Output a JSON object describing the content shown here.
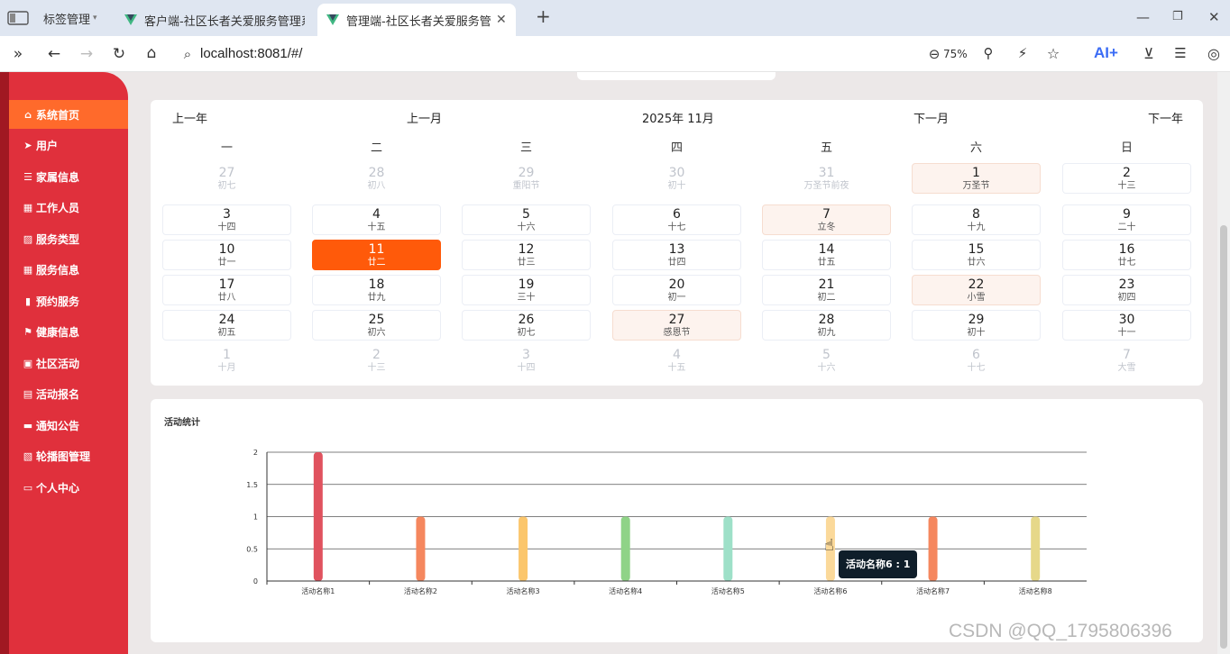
{
  "browser": {
    "tab_group_label": "标签管理",
    "tabs": [
      {
        "title": "客户端-社区长者关爱服务管理系"
      },
      {
        "title": "管理端-社区长者关爱服务管理"
      }
    ],
    "url": "localhost:8081/#/",
    "zoom": "75%",
    "ai_label": "AI+"
  },
  "sidebar": {
    "items": [
      {
        "label": "系统首页",
        "icon": "home-icon"
      },
      {
        "label": "用户",
        "icon": "paper-plane-icon"
      },
      {
        "label": "家属信息",
        "icon": "list-icon"
      },
      {
        "label": "工作人员",
        "icon": "grid-icon"
      },
      {
        "label": "服务类型",
        "icon": "chart-icon"
      },
      {
        "label": "服务信息",
        "icon": "grid-icon"
      },
      {
        "label": "预约服务",
        "icon": "bar-chart-icon"
      },
      {
        "label": "健康信息",
        "icon": "flag-icon"
      },
      {
        "label": "社区活动",
        "icon": "monitor-icon"
      },
      {
        "label": "活动报名",
        "icon": "basket-icon"
      },
      {
        "label": "通知公告",
        "icon": "comment-icon"
      },
      {
        "label": "轮播图管理",
        "icon": "clipboard-icon"
      },
      {
        "label": "个人中心",
        "icon": "card-icon"
      }
    ]
  },
  "calendar": {
    "prev_year": "上一年",
    "prev_month": "上一月",
    "title": "2025年 11月",
    "next_month": "下一月",
    "next_year": "下一年",
    "weekdays": [
      "一",
      "二",
      "三",
      "四",
      "五",
      "六",
      "日"
    ],
    "weeks": [
      [
        {
          "d": "27",
          "l": "初七",
          "t": "other"
        },
        {
          "d": "28",
          "l": "初八",
          "t": "other"
        },
        {
          "d": "29",
          "l": "重阳节",
          "t": "other"
        },
        {
          "d": "30",
          "l": "初十",
          "t": "other"
        },
        {
          "d": "31",
          "l": "万圣节前夜",
          "t": "other"
        },
        {
          "d": "1",
          "l": "万圣节",
          "t": "fest"
        },
        {
          "d": "2",
          "l": "十三",
          "t": ""
        }
      ],
      [
        {
          "d": "3",
          "l": "十四",
          "t": ""
        },
        {
          "d": "4",
          "l": "十五",
          "t": ""
        },
        {
          "d": "5",
          "l": "十六",
          "t": ""
        },
        {
          "d": "6",
          "l": "十七",
          "t": ""
        },
        {
          "d": "7",
          "l": "立冬",
          "t": "fest"
        },
        {
          "d": "8",
          "l": "十九",
          "t": ""
        },
        {
          "d": "9",
          "l": "二十",
          "t": ""
        }
      ],
      [
        {
          "d": "10",
          "l": "廿一",
          "t": ""
        },
        {
          "d": "11",
          "l": "廿二",
          "t": "today"
        },
        {
          "d": "12",
          "l": "廿三",
          "t": ""
        },
        {
          "d": "13",
          "l": "廿四",
          "t": ""
        },
        {
          "d": "14",
          "l": "廿五",
          "t": ""
        },
        {
          "d": "15",
          "l": "廿六",
          "t": ""
        },
        {
          "d": "16",
          "l": "廿七",
          "t": ""
        }
      ],
      [
        {
          "d": "17",
          "l": "廿八",
          "t": ""
        },
        {
          "d": "18",
          "l": "廿九",
          "t": ""
        },
        {
          "d": "19",
          "l": "三十",
          "t": ""
        },
        {
          "d": "20",
          "l": "初一",
          "t": ""
        },
        {
          "d": "21",
          "l": "初二",
          "t": ""
        },
        {
          "d": "22",
          "l": "小雪",
          "t": "fest"
        },
        {
          "d": "23",
          "l": "初四",
          "t": ""
        }
      ],
      [
        {
          "d": "24",
          "l": "初五",
          "t": ""
        },
        {
          "d": "25",
          "l": "初六",
          "t": ""
        },
        {
          "d": "26",
          "l": "初七",
          "t": ""
        },
        {
          "d": "27",
          "l": "感恩节",
          "t": "fest"
        },
        {
          "d": "28",
          "l": "初九",
          "t": ""
        },
        {
          "d": "29",
          "l": "初十",
          "t": ""
        },
        {
          "d": "30",
          "l": "十一",
          "t": ""
        }
      ],
      [
        {
          "d": "1",
          "l": "十月",
          "t": "other"
        },
        {
          "d": "2",
          "l": "十三",
          "t": "other"
        },
        {
          "d": "3",
          "l": "十四",
          "t": "other"
        },
        {
          "d": "4",
          "l": "十五",
          "t": "other"
        },
        {
          "d": "5",
          "l": "十六",
          "t": "other"
        },
        {
          "d": "6",
          "l": "十七",
          "t": "other"
        },
        {
          "d": "7",
          "l": "大雪",
          "t": "other"
        }
      ]
    ]
  },
  "chart_data": {
    "type": "bar",
    "title": "活动统计",
    "categories": [
      "活动名称1",
      "活动名称2",
      "活动名称3",
      "活动名称4",
      "活动名称5",
      "活动名称6",
      "活动名称7",
      "活动名称8"
    ],
    "values": [
      2,
      1,
      1,
      1,
      1,
      1,
      1,
      1
    ],
    "colors": [
      "#e0525e",
      "#f5875e",
      "#fbc66c",
      "#8fd387",
      "#9ee0c8",
      "#fbd99a",
      "#f5875e",
      "#e6d889"
    ],
    "yticks": [
      "0",
      "0.5",
      "1",
      "1.5",
      "2"
    ],
    "ylim": [
      0,
      2
    ],
    "grid": true,
    "tooltip": "活动名称6 : 1"
  },
  "watermark": "CSDN @QQ_1795806396"
}
